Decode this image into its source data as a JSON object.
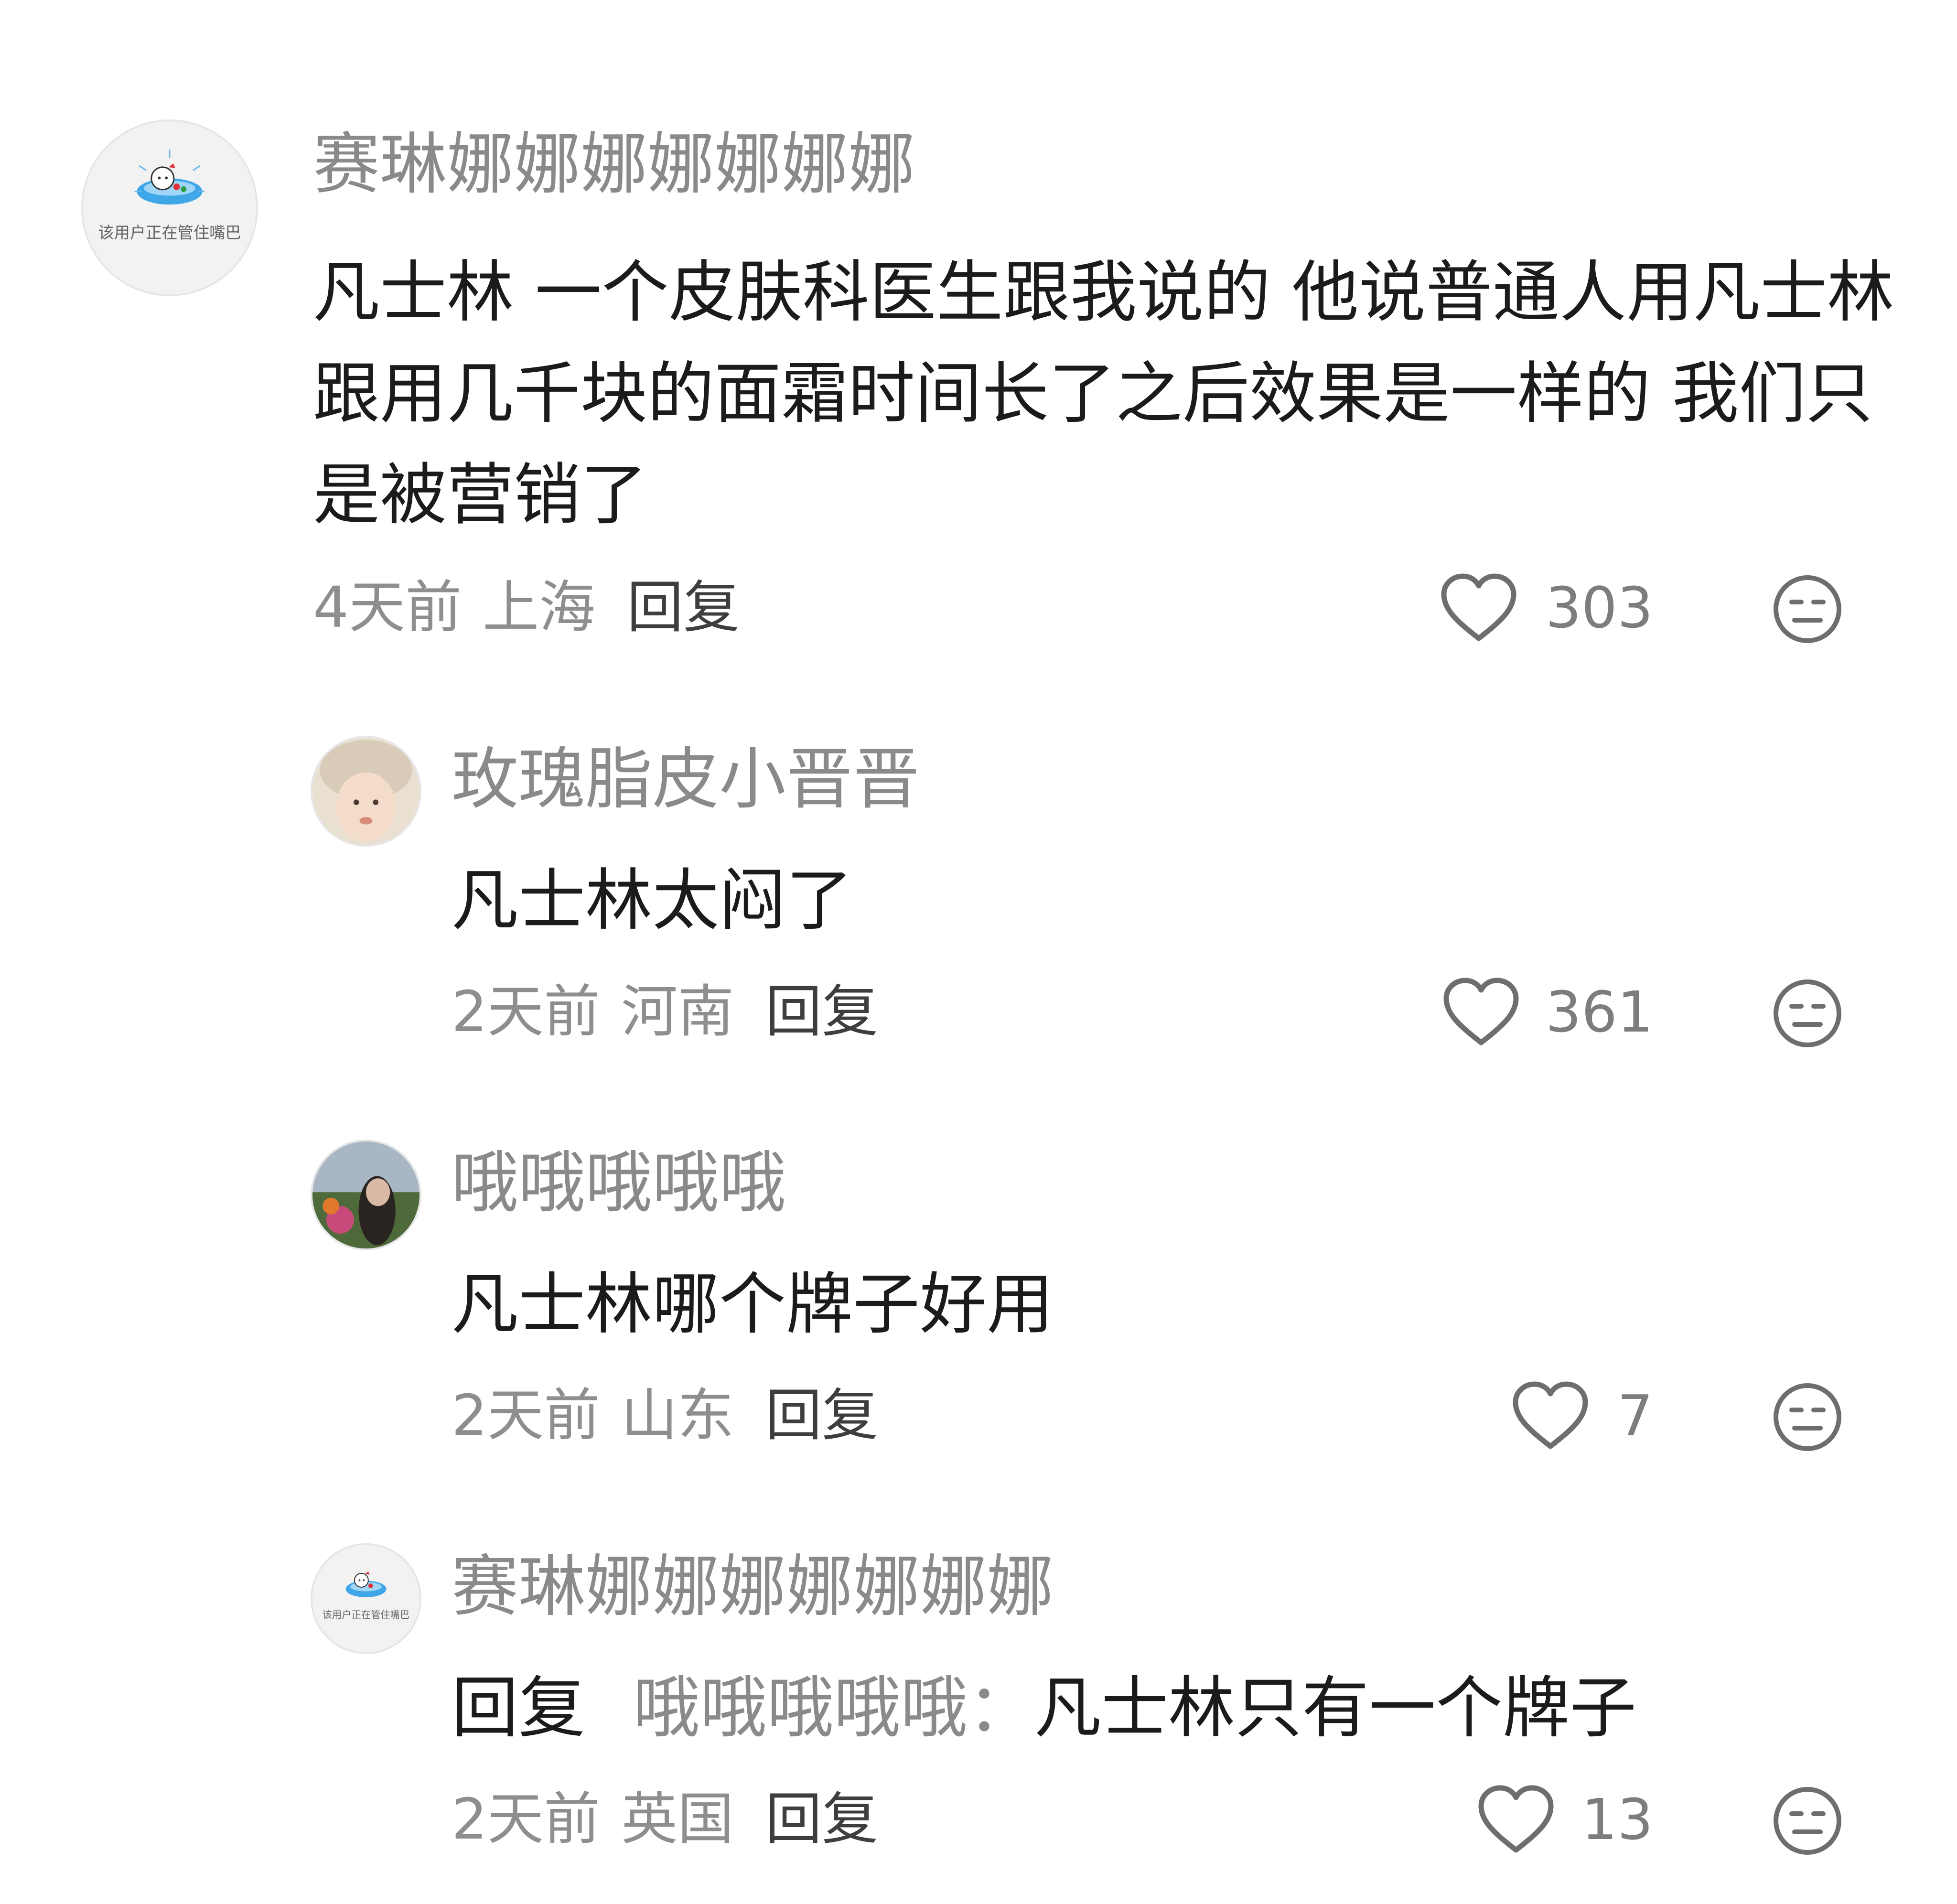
{
  "comments": [
    {
      "username": "赛琳娜娜娜娜娜娜娜",
      "avatar_icon": "hello-kitty-pool-avatar",
      "avatar_caption": "该用户正在管住嘴巴",
      "text": "凡士林 一个皮肤科医生跟我说的 他说普通人用凡士林跟用几千块的面霜时间长了之后效果是一样的 我们只是被营销了",
      "time": "4天前",
      "location": "上海",
      "reply_label": "回复",
      "likes": "303"
    },
    {
      "username": "玫瑰脂皮小晋晋",
      "avatar_icon": "child-photo-avatar",
      "text": "凡士林太闷了",
      "time": "2天前",
      "location": "河南",
      "reply_label": "回复",
      "likes": "361"
    },
    {
      "username": "哦哦哦哦哦",
      "avatar_icon": "garden-photo-avatar",
      "text": "凡士林哪个牌子好用",
      "time": "2天前",
      "location": "山东",
      "reply_label": "回复",
      "likes": "7"
    },
    {
      "username": "赛琳娜娜娜娜娜娜娜",
      "avatar_icon": "hello-kitty-pool-avatar",
      "avatar_caption": "该用户正在管住嘴巴",
      "reply_prefix": "回复",
      "reply_to": "哦哦哦哦哦：",
      "text": "凡士林只有一个牌子",
      "time": "2天前",
      "location": "英国",
      "reply_label": "回复",
      "likes": "13"
    }
  ],
  "icons": {
    "like": "heart-outline-icon",
    "dislike": "neutral-face-icon"
  },
  "colors": {
    "username": "#8a8a8a",
    "content": "#1b1b1b",
    "meta": "#8e8e8e",
    "icon": "#6e6e6e"
  }
}
